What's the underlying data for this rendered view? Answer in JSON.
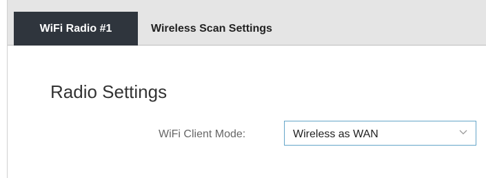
{
  "tabs": [
    {
      "label": "WiFi Radio #1",
      "active": true
    },
    {
      "label": "Wireless Scan Settings",
      "active": false
    }
  ],
  "main": {
    "section_title": "Radio Settings",
    "client_mode": {
      "label": "WiFi Client Mode:",
      "selected": "Wireless as WAN",
      "icon": "chevron-down-icon"
    }
  },
  "colors": {
    "tab_active_bg": "#2f353d",
    "tab_bar_bg": "#e5e5e5",
    "select_border": "#63a4c8"
  }
}
